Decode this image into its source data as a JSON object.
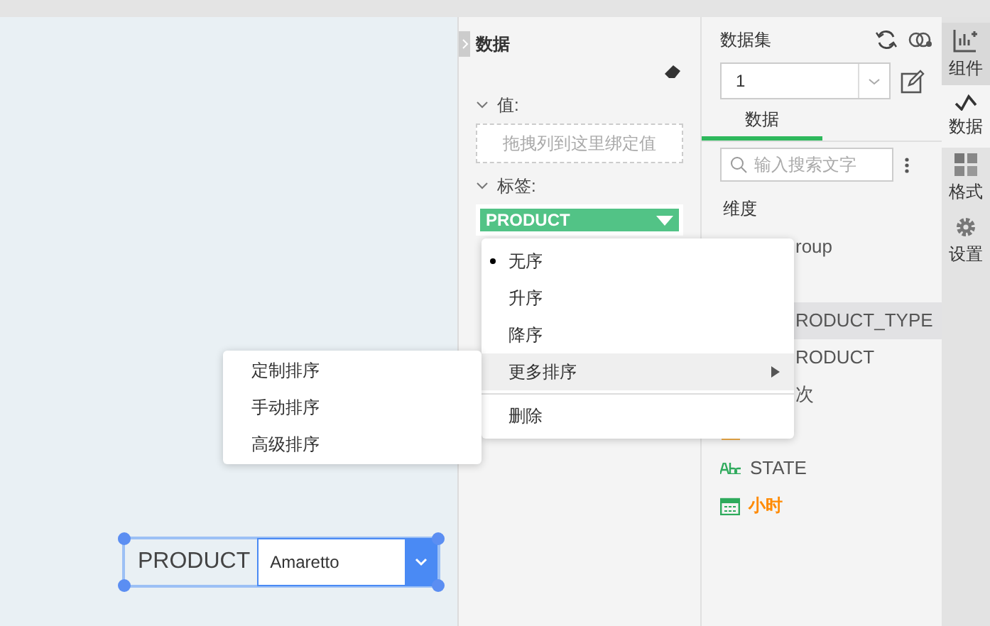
{
  "panel": {
    "title": "数据",
    "value_label": "值:",
    "value_placeholder": "拖拽列到这里绑定值",
    "label_label": "标签:",
    "label_field": "PRODUCT",
    "value_expanded": true,
    "label_expanded": true
  },
  "dataset": {
    "title": "数据集",
    "select_value": "1",
    "tab": "数据",
    "search_placeholder": "输入搜索文字",
    "section": "维度",
    "fields": [
      {
        "kind": "covered",
        "text": "roup"
      },
      {
        "kind": "blank"
      },
      {
        "kind": "covered",
        "text": "RODUCT_TYPE",
        "selected": true
      },
      {
        "kind": "covered",
        "text": "RODUCT",
        "selected": false
      },
      {
        "kind": "covered",
        "text": "次",
        "selected": false
      },
      {
        "kind": "hidden-date",
        "selected": false
      },
      {
        "kind": "text",
        "text": "STATE",
        "selected": false
      },
      {
        "kind": "date",
        "text": "小时",
        "selected": false
      }
    ]
  },
  "side_tabs": [
    {
      "label": "组件",
      "kind": "component",
      "selected": false
    },
    {
      "label": "数据",
      "kind": "data",
      "selected": true
    },
    {
      "label": "格式",
      "kind": "format",
      "selected": false
    },
    {
      "label": "设置",
      "kind": "settings",
      "selected": false
    }
  ],
  "menu": [
    {
      "label": "无序",
      "checked": true,
      "kind": "item"
    },
    {
      "label": "升序",
      "checked": false,
      "kind": "item"
    },
    {
      "label": "降序",
      "checked": false,
      "kind": "item"
    },
    {
      "label": "更多排序",
      "checked": false,
      "kind": "submenu",
      "selected": true
    },
    {
      "label": "删除",
      "checked": false,
      "kind": "item",
      "divider": true
    }
  ],
  "submenu": [
    "定制排序",
    "手动排序",
    "高级排序"
  ],
  "widget": {
    "label": "PRODUCT",
    "value": "Amaretto"
  }
}
